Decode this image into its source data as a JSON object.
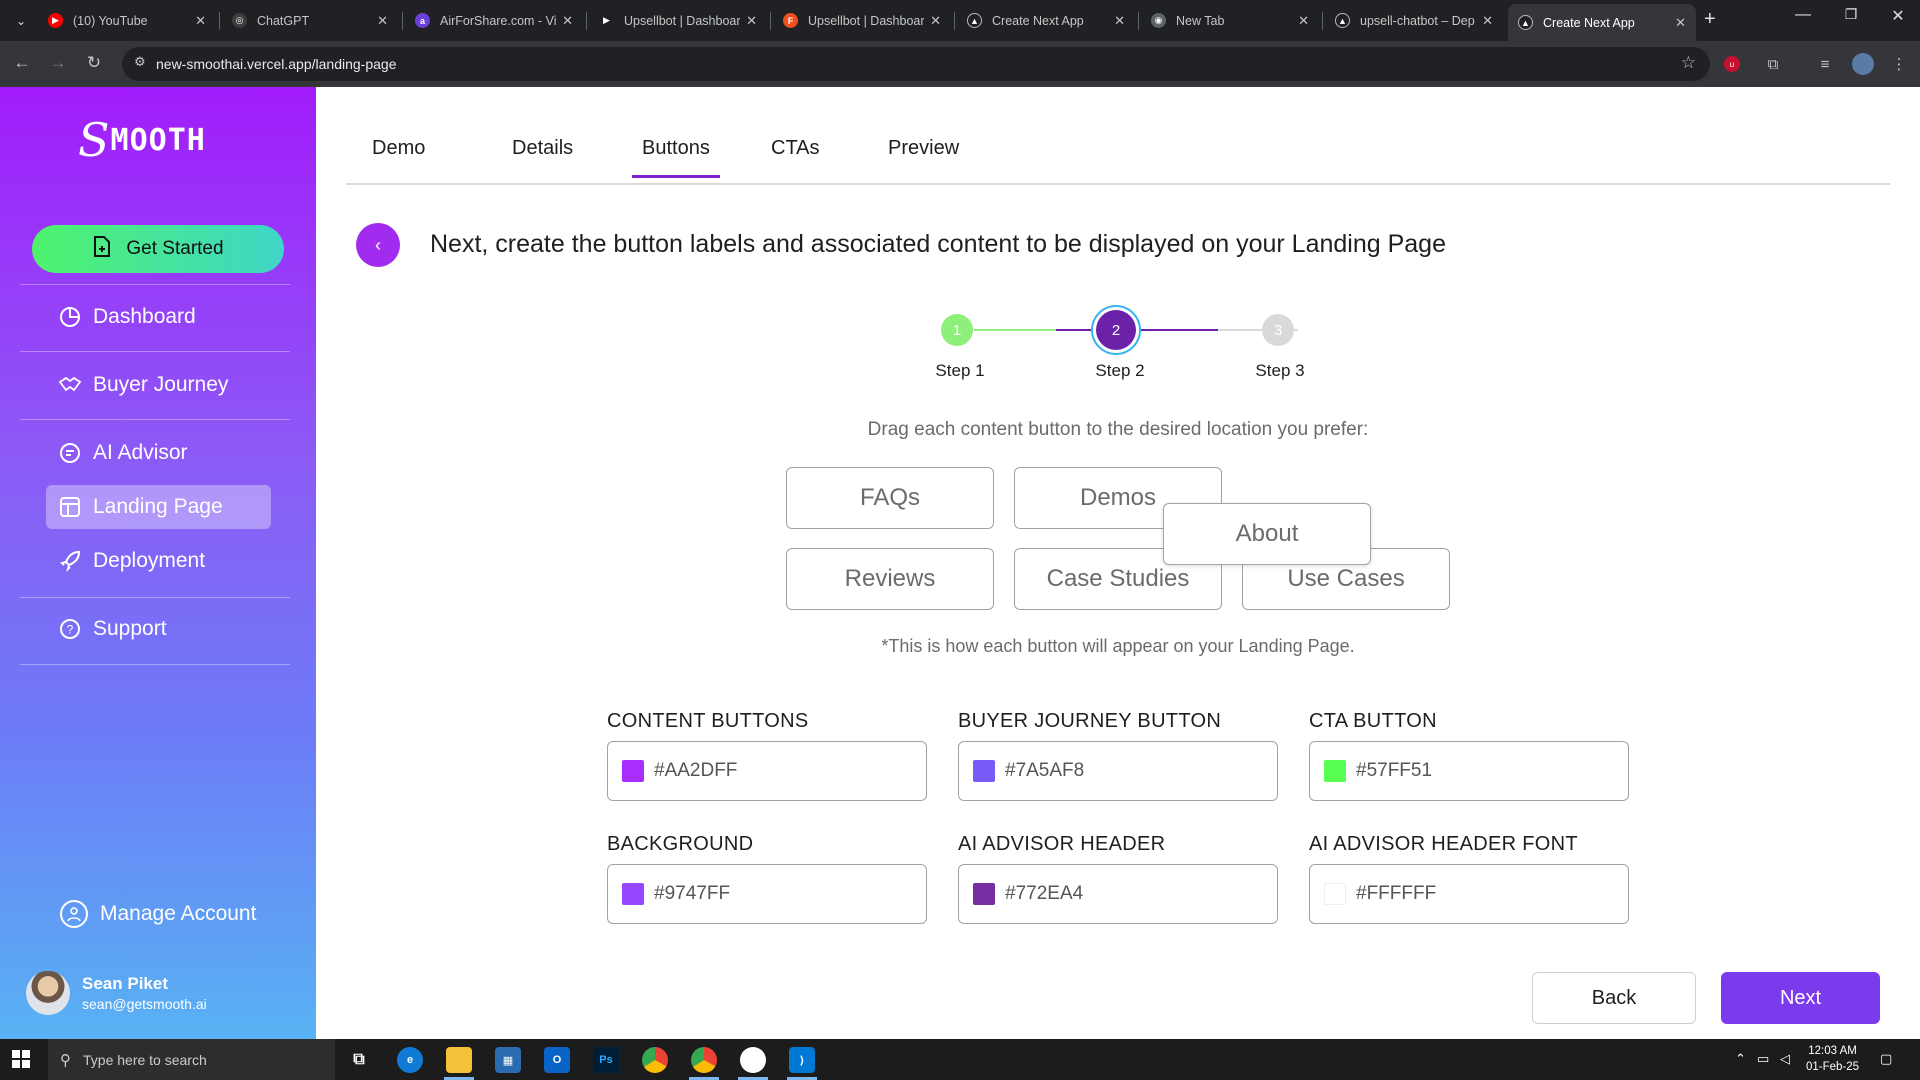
{
  "browser": {
    "tabs": [
      {
        "title": "(10) YouTube",
        "icon": "youtube-icon",
        "color": "#ff0000",
        "glyph": "▶"
      },
      {
        "title": "ChatGPT",
        "icon": "chatgpt-icon",
        "color": "#3c3c3c",
        "glyph": "◎"
      },
      {
        "title": "AirForShare.com - Vir",
        "icon": "airforshare-icon",
        "color": "#6d3fd9",
        "glyph": "a"
      },
      {
        "title": "Upsellbot | Dashboar",
        "icon": "upsellbot-icon",
        "color": "#202124",
        "glyph": "▶"
      },
      {
        "title": "Upsellbot | Dashboar",
        "icon": "figma-icon",
        "color": "#f24e1e",
        "glyph": "F"
      },
      {
        "title": "Create Next App",
        "icon": "vercel-icon",
        "color": "#202124",
        "glyph": "▲"
      },
      {
        "title": "New Tab",
        "icon": "chrome-icon",
        "color": "#5f6368",
        "glyph": "◉"
      },
      {
        "title": "upsell-chatbot – Dep",
        "icon": "vercel-icon",
        "color": "#202124",
        "glyph": "▲"
      },
      {
        "title": "Create Next App",
        "icon": "vercel-icon",
        "color": "#202124",
        "glyph": "▲"
      }
    ],
    "url": "new-smoothai.vercel.app/landing-page"
  },
  "sidebar": {
    "logo_initial": "S",
    "logo_text": "MOOTH",
    "get_started": "Get Started",
    "items": [
      {
        "label": "Dashboard"
      },
      {
        "label": "Buyer Journey"
      },
      {
        "label": "AI Advisor"
      },
      {
        "label": "Landing Page"
      },
      {
        "label": "Deployment"
      },
      {
        "label": "Support"
      }
    ],
    "manage_account": "Manage Account",
    "user": {
      "name": "Sean Piket",
      "email": "sean@getsmooth.ai"
    }
  },
  "main": {
    "tabs": [
      "Demo",
      "Details",
      "Buttons",
      "CTAs",
      "Preview"
    ],
    "active_tab": "Buttons",
    "heading": "Next, create the button labels and associated content to be displayed on your Landing Page",
    "steps": [
      {
        "number": "1",
        "label": "Step 1",
        "state": "done"
      },
      {
        "number": "2",
        "label": "Step 2",
        "state": "active"
      },
      {
        "number": "3",
        "label": "Step 3",
        "state": "pending"
      }
    ],
    "drag_hint": "Drag each content button to the desired location you prefer:",
    "content_buttons": [
      "FAQs",
      "Demos",
      "About",
      "Reviews",
      "Case Studies",
      "Use Cases"
    ],
    "appear_note": "*This is how each button will appear on your Landing Page.",
    "color_fields": [
      {
        "label": "CONTENT BUTTONS",
        "value": "#AA2DFF",
        "swatch": "#aa2dff"
      },
      {
        "label": "BUYER JOURNEY BUTTON",
        "value": "#7A5AF8",
        "swatch": "#7a5af8"
      },
      {
        "label": "CTA BUTTON",
        "value": "#57FF51",
        "swatch": "#57ff51"
      },
      {
        "label": "BACKGROUND",
        "value": "#9747FF",
        "swatch": "#9747ff"
      },
      {
        "label": "AI ADVISOR HEADER",
        "value": "#772EA4",
        "swatch": "#772ea4"
      },
      {
        "label": "AI ADVISOR HEADER FONT",
        "value": "#FFFFFF",
        "swatch": "#ffffff"
      }
    ],
    "back_label": "Back",
    "next_label": "Next"
  },
  "taskbar": {
    "search_placeholder": "Type here to search",
    "time": "12:03 AM",
    "date": "01-Feb-25"
  },
  "colors": {
    "accent": "#7c3aed",
    "step_done": "#8ef07a",
    "step_active": "#6b21a8",
    "step_pending": "#d9d9d9"
  }
}
